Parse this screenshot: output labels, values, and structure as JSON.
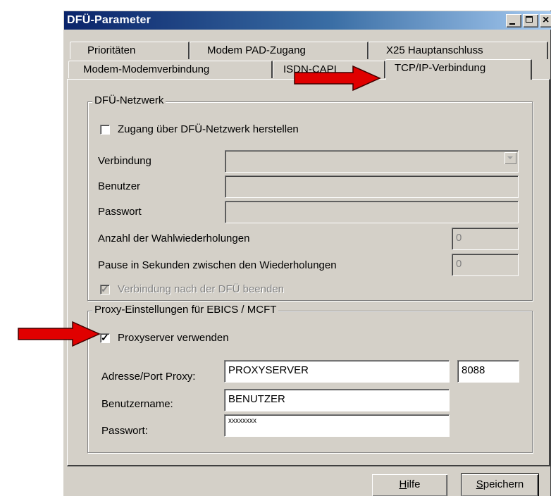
{
  "window": {
    "title": "DFÜ-Parameter"
  },
  "tabs_row1": [
    "Prioritäten",
    "Modem PAD-Zugang",
    "X25  Hauptanschluss"
  ],
  "tabs_row2": [
    "Modem-Modemverbindung",
    "ISDN-CAPI",
    "TCP/IP-Verbindung"
  ],
  "dfu": {
    "legend": "DFÜ-Netzwerk",
    "checkbox_label": "Zugang über DFÜ-Netzwerk herstellen",
    "verbindung_label": "Verbindung",
    "benutzer_label": "Benutzer",
    "passwort_label": "Passwort",
    "wahl_label": "Anzahl der Wahlwiederholungen",
    "wahl_value": "0",
    "pause_label": "Pause in Sekunden zwischen den Wiederholungen",
    "pause_value": "0",
    "beenden_label": "Verbindung nach der DFÜ beenden"
  },
  "proxy": {
    "legend": "Proxy-Einstellungen für EBICS / MCFT",
    "checkbox_label": "Proxyserver verwenden",
    "adresse_label": "Adresse/Port Proxy:",
    "adresse_value": "PROXYSERVER",
    "port_value": "8088",
    "user_label": "Benutzername:",
    "user_value": "BENUTZER",
    "pw_label": "Passwort:",
    "pw_value": "xxxxxxxx"
  },
  "buttons": {
    "help_mnemonic": "H",
    "help_rest": "ilfe",
    "save_mnemonic": "S",
    "save_rest": "peichern"
  },
  "colors": {
    "arrow": "#e00000",
    "titlebar": "#0a246a",
    "face": "#d4d0c8"
  }
}
